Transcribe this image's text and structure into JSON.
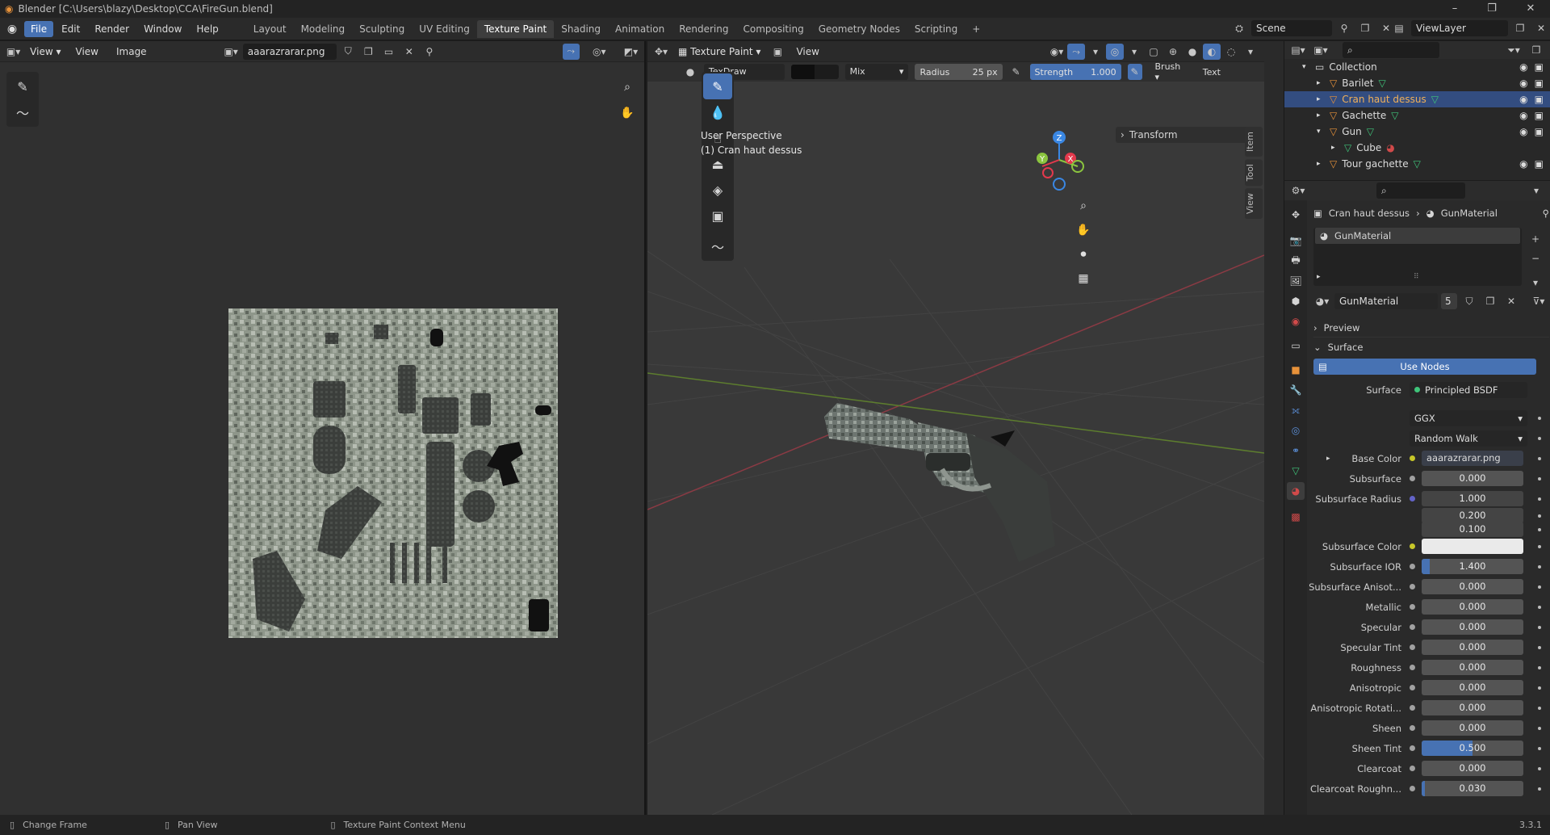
{
  "title_bar": {
    "text": "Blender [C:\\Users\\blazy\\Desktop\\CCA\\FireGun.blend]",
    "controls": [
      "–",
      "❐",
      "✕"
    ]
  },
  "menus": [
    "File",
    "Edit",
    "Render",
    "Window",
    "Help"
  ],
  "workspaces": [
    "Layout",
    "Modeling",
    "Sculpting",
    "UV Editing",
    "Texture Paint",
    "Shading",
    "Animation",
    "Rendering",
    "Compositing",
    "Geometry Nodes",
    "Scripting",
    "+"
  ],
  "active_workspace": "Texture Paint",
  "scene": {
    "name": "Scene",
    "view_layer": "ViewLayer"
  },
  "image_editor": {
    "view_dropdown": "View",
    "menus": [
      "View",
      "Image"
    ],
    "image_name": "aaarazrarar.png"
  },
  "viewport": {
    "mode": "Texture Paint",
    "view_menu": "View",
    "brush_name": "TexDraw",
    "blend": "Mix",
    "radius_label": "Radius",
    "radius_value": "25 px",
    "strength_label": "Strength",
    "strength_value": "1.000",
    "strength_fraction": 1.0,
    "brush_menu": "Brush",
    "texture_menu": "Text",
    "overlay_line1": "User Perspective",
    "overlay_line2": "(1) Cran haut dessus",
    "transform_panel": "Transform",
    "side_tabs": [
      "Item",
      "Tool",
      "View"
    ],
    "gizmo_axes": {
      "x": "X",
      "y": "Y",
      "z": "Z"
    }
  },
  "outliner": {
    "items": [
      {
        "label": "Collection",
        "depth": 0
      },
      {
        "label": "Barilet",
        "depth": 1
      },
      {
        "label": "Cran haut dessus",
        "depth": 1,
        "selected": true
      },
      {
        "label": "Gachette",
        "depth": 1
      },
      {
        "label": "Gun",
        "depth": 1
      },
      {
        "label": "Cube",
        "depth": 2
      },
      {
        "label": "Tour gachette",
        "depth": 1
      }
    ]
  },
  "properties": {
    "breadcrumb_object": "Cran haut dessus",
    "breadcrumb_material": "GunMaterial",
    "slot_name": "GunMaterial",
    "material_name": "GunMaterial",
    "user_count": "5",
    "preview_label": "Preview",
    "surface_label": "Surface",
    "use_nodes": "Use Nodes",
    "surface_shader_label": "Surface",
    "surface_shader": "Principled BSDF",
    "distribution": "GGX",
    "subsurface_method": "Random Walk",
    "base_color_label": "Base Color",
    "base_color_value": "aaarazrarar.png",
    "fields": [
      {
        "label": "Subsurface",
        "value": "0.000",
        "fraction": 0
      },
      {
        "label": "Subsurface Radius",
        "value": "1.000",
        "fraction": 0
      },
      {
        "label": "",
        "value": "0.200",
        "fraction": 0
      },
      {
        "label": "",
        "value": "0.100",
        "fraction": 0
      },
      {
        "label": "Subsurface Color",
        "value": "",
        "fraction": 0,
        "swatch": "#eaeaea"
      },
      {
        "label": "Subsurface IOR",
        "value": "1.400",
        "fraction": 0.08
      },
      {
        "label": "Subsurface Anisot...",
        "value": "0.000",
        "fraction": 0
      },
      {
        "label": "Metallic",
        "value": "0.000",
        "fraction": 0
      },
      {
        "label": "Specular",
        "value": "0.000",
        "fraction": 0
      },
      {
        "label": "Specular Tint",
        "value": "0.000",
        "fraction": 0
      },
      {
        "label": "Roughness",
        "value": "0.000",
        "fraction": 0
      },
      {
        "label": "Anisotropic",
        "value": "0.000",
        "fraction": 0
      },
      {
        "label": "Anisotropic Rotati...",
        "value": "0.000",
        "fraction": 0
      },
      {
        "label": "Sheen",
        "value": "0.000",
        "fraction": 0
      },
      {
        "label": "Sheen Tint",
        "value": "0.500",
        "fraction": 0.5
      },
      {
        "label": "Clearcoat",
        "value": "0.000",
        "fraction": 0
      },
      {
        "label": "Clearcoat Roughn...",
        "value": "0.030",
        "fraction": 0.03
      }
    ]
  },
  "status_bar": {
    "left": "Change Frame",
    "middle": "Pan View",
    "right": "Texture Paint Context Menu",
    "version": "3.3.1"
  },
  "colors": {
    "accent": "#4772b3",
    "selected_row": "#334d80",
    "object_icon": "#e8923a",
    "mesh_icon": "#3fc47a",
    "axis_x": "#e3394c",
    "axis_y": "#8bc53f",
    "axis_z": "#3a87e3"
  }
}
